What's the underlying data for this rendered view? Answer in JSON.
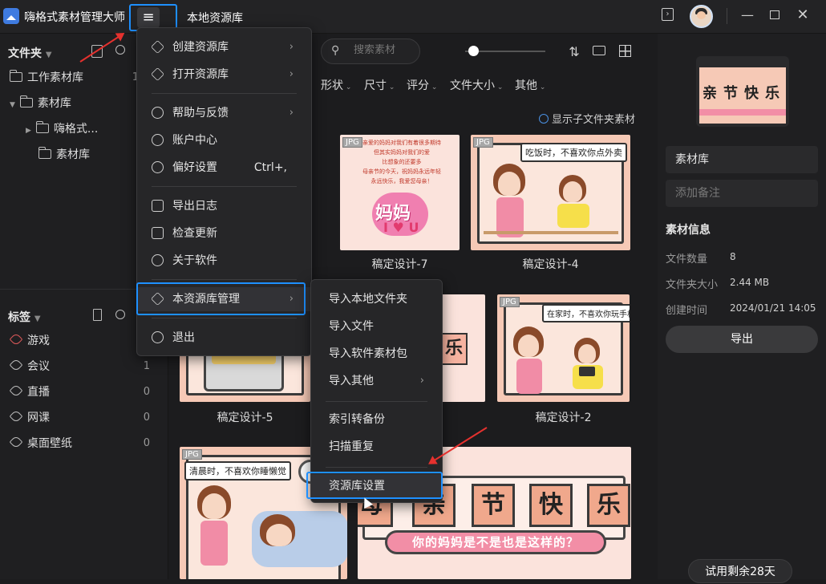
{
  "app": {
    "title": "嗨格式素材管理大师",
    "library_title": "本地资源库",
    "menu_icon": "≡"
  },
  "titlebar_icons": [
    "sidebar-toggle-icon",
    "avatar",
    "minimize-icon",
    "maximize-icon",
    "close-icon"
  ],
  "sidebar": {
    "folders_header": "文件夹",
    "folders": [
      {
        "label": "工作素材库",
        "count": "1"
      },
      {
        "label": "素材库",
        "count": ""
      },
      {
        "label": "嗨格式...",
        "count": ""
      },
      {
        "label": "素材库",
        "count": ""
      }
    ],
    "tags_header": "标签",
    "tags": [
      {
        "label": "游戏",
        "count": ""
      },
      {
        "label": "会议",
        "count": "1"
      },
      {
        "label": "直播",
        "count": "0"
      },
      {
        "label": "网课",
        "count": "0"
      },
      {
        "label": "桌面壁纸",
        "count": "0"
      }
    ]
  },
  "toolbar": {
    "search_placeholder": "搜索素材",
    "filters": [
      "形状",
      "尺寸",
      "评分",
      "文件大小",
      "其他"
    ],
    "show_subfolder": "显示子文件夹素材"
  },
  "cards": [
    {
      "name": "稿定设计-7",
      "badge": "JPG",
      "text_lines": [
        "亲爱的妈妈对我们有着很多期待",
        "但其实妈妈对我们的爱",
        "比想象的还要多",
        "母亲节的今天，祝妈妈永远年轻",
        "永远快乐，我爱您母亲！"
      ],
      "center_text": "妈妈",
      "sub_text": "I ♥ U"
    },
    {
      "name": "稿定设计-4",
      "badge": "JPG",
      "bubble": "吃饭时，不喜欢你点外卖"
    },
    {
      "name": "稿定设计-5",
      "badge": ""
    },
    {
      "name": "稿定设计-2",
      "badge": "JPG",
      "bubble": "在家时，不喜欢你玩手机"
    },
    {
      "name": "",
      "badge": "JPG",
      "bubble": "清晨时，不喜欢你睡懒觉"
    },
    {
      "name": "",
      "badge": "",
      "chars": [
        "母",
        "亲",
        "节",
        "快",
        "乐"
      ],
      "slogan": "你的妈妈是不是也是这样的？"
    },
    {
      "name": "",
      "badge": "",
      "partial_char": "乐"
    }
  ],
  "main_menu": {
    "items": [
      {
        "label": "创建资源库",
        "shortcut": "",
        "arrow": "›"
      },
      {
        "label": "打开资源库",
        "shortcut": "",
        "arrow": "›"
      },
      {
        "label": "帮助与反馈",
        "shortcut": "",
        "arrow": "›"
      },
      {
        "label": "账户中心",
        "shortcut": "",
        "arrow": ""
      },
      {
        "label": "偏好设置",
        "shortcut": "Ctrl+,",
        "arrow": ""
      },
      {
        "label": "导出日志",
        "shortcut": "",
        "arrow": ""
      },
      {
        "label": "检查更新",
        "shortcut": "",
        "arrow": ""
      },
      {
        "label": "关于软件",
        "shortcut": "",
        "arrow": ""
      },
      {
        "label": "本资源库管理",
        "shortcut": "",
        "arrow": "›"
      },
      {
        "label": "退出",
        "shortcut": "",
        "arrow": ""
      }
    ]
  },
  "sub_menu": {
    "items": [
      {
        "label": "导入本地文件夹",
        "arrow": ""
      },
      {
        "label": "导入文件",
        "arrow": ""
      },
      {
        "label": "导入软件素材包",
        "arrow": ""
      },
      {
        "label": "导入其他",
        "arrow": "›"
      },
      {
        "label": "索引转备份",
        "arrow": ""
      },
      {
        "label": "扫描重复",
        "arrow": ""
      },
      {
        "label": "资源库设置",
        "arrow": ""
      }
    ]
  },
  "right_panel": {
    "name_value": "素材库",
    "note_placeholder": "添加备注",
    "info_header": "素材信息",
    "info": [
      {
        "key": "文件数量",
        "value": "8"
      },
      {
        "key": "文件夹大小",
        "value": "2.44 MB"
      },
      {
        "key": "创建时间",
        "value": "2024/01/21 14:05"
      }
    ],
    "export_label": "导出",
    "thumb_chars": [
      "亲",
      "节",
      "快",
      "乐"
    ]
  },
  "trial_label": "试用剩余28天",
  "colors": {
    "accent": "#1e90ff",
    "annotation_arrow": "#e5312e",
    "card_bg": "#f6c9b6"
  }
}
